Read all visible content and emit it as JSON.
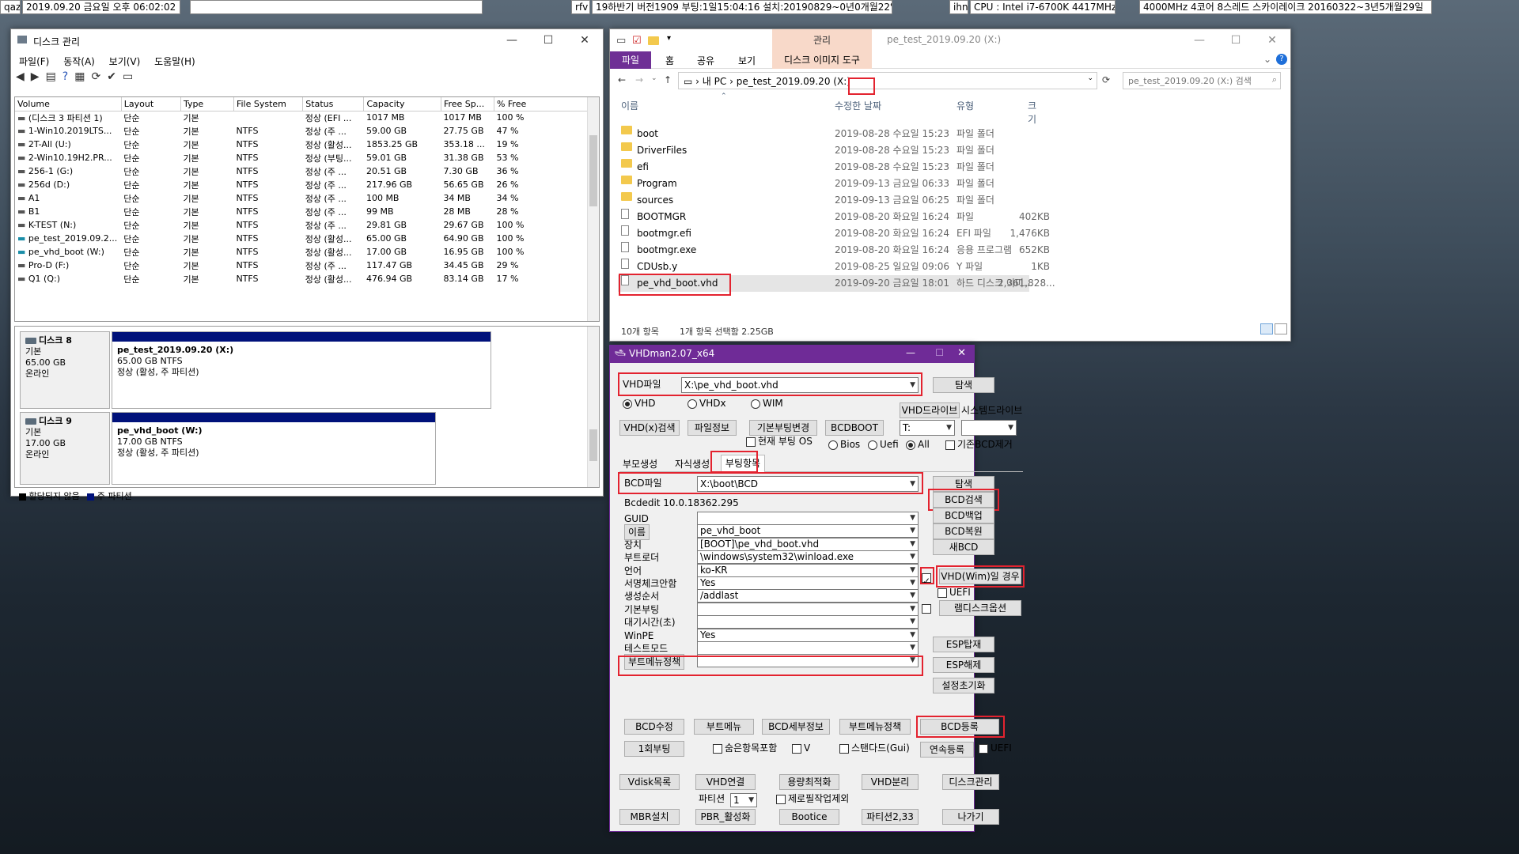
{
  "taskbar": {
    "left_tag": "qaz",
    "datetime": "2019.09.20 금요일 오후 06:02:02",
    "mid_tag": "rfv",
    "build": "19하반기 버전1909 부팅:1일15:04:16 설치:20190829~0년0개월22일",
    "cpu_tag": "ihn",
    "cpu": "CPU : Intel i7-6700K 4417MHz",
    "cpu2": "4000MHz 4코어 8스레드 스카이레이크 20160322~3년5개월29일"
  },
  "disk_mgmt": {
    "title": "디스크 관리",
    "menu": [
      "파일(F)",
      "동작(A)",
      "보기(V)",
      "도움말(H)"
    ],
    "columns": [
      "Volume",
      "Layout",
      "Type",
      "File System",
      "Status",
      "Capacity",
      "Free Sp...",
      "% Free"
    ],
    "rows": [
      [
        "(디스크 3 파티션 1)",
        "단순",
        "기본",
        "",
        "정상 (EFI ...",
        "1017 MB",
        "1017 MB",
        "100 %"
      ],
      [
        "1-Win10.2019LTS...",
        "단순",
        "기본",
        "NTFS",
        "정상 (주 ...",
        "59.00 GB",
        "27.75 GB",
        "47 %"
      ],
      [
        "2T-All (U:)",
        "단순",
        "기본",
        "NTFS",
        "정상 (활성...",
        "1853.25 GB",
        "353.18 ...",
        "19 %"
      ],
      [
        "2-Win10.19H2.PR...",
        "단순",
        "기본",
        "NTFS",
        "정상 (부팅...",
        "59.01 GB",
        "31.38 GB",
        "53 %"
      ],
      [
        "256-1 (G:)",
        "단순",
        "기본",
        "NTFS",
        "정상 (주 ...",
        "20.51 GB",
        "7.30 GB",
        "36 %"
      ],
      [
        "256d (D:)",
        "단순",
        "기본",
        "NTFS",
        "정상 (주 ...",
        "217.96 GB",
        "56.65 GB",
        "26 %"
      ],
      [
        "A1",
        "단순",
        "기본",
        "NTFS",
        "정상 (주 ...",
        "100 MB",
        "34 MB",
        "34 %"
      ],
      [
        "B1",
        "단순",
        "기본",
        "NTFS",
        "정상 (주 ...",
        "99 MB",
        "28 MB",
        "28 %"
      ],
      [
        "K-TEST (N:)",
        "단순",
        "기본",
        "NTFS",
        "정상 (주 ...",
        "29.81 GB",
        "29.67 GB",
        "100 %"
      ],
      [
        "pe_test_2019.09.2...",
        "단순",
        "기본",
        "NTFS",
        "정상 (활성...",
        "65.00 GB",
        "64.90 GB",
        "100 %"
      ],
      [
        "pe_vhd_boot (W:)",
        "단순",
        "기본",
        "NTFS",
        "정상 (활성...",
        "17.00 GB",
        "16.95 GB",
        "100 %"
      ],
      [
        "Pro-D (F:)",
        "단순",
        "기본",
        "NTFS",
        "정상 (주 ...",
        "117.47 GB",
        "34.45 GB",
        "29 %"
      ],
      [
        "Q1 (Q:)",
        "단순",
        "기본",
        "NTFS",
        "정상 (활성...",
        "476.94 GB",
        "83.14 GB",
        "17 %"
      ]
    ],
    "disk8": {
      "name": "디스크 8",
      "type": "기본",
      "size": "65.00 GB",
      "state": "온라인",
      "vol": "pe_test_2019.09.20  (X:)",
      "vol_size": "65.00 GB NTFS",
      "vol_state": "정상 (활성, 주 파티션)"
    },
    "disk9": {
      "name": "디스크 9",
      "type": "기본",
      "size": "17.00 GB",
      "state": "온라인",
      "vol": "pe_vhd_boot  (W:)",
      "vol_size": "17.00 GB NTFS",
      "vol_state": "정상 (활성, 주 파티션)"
    },
    "legend": [
      "할당되지 않음",
      "주 파티션"
    ]
  },
  "explorer": {
    "context_tab": "관리",
    "title": "pe_test_2019.09.20 (X:)",
    "ribbon": [
      "파일",
      "홈",
      "공유",
      "보기",
      "디스크 이미지 도구"
    ],
    "address": [
      "내 PC",
      "pe_test_2019.09.20",
      "(X:)"
    ],
    "search": "pe_test_2019.09.20 (X:) 검색",
    "columns": [
      "이름",
      "수정한 날짜",
      "유형",
      "크기"
    ],
    "rows": [
      {
        "name": "boot",
        "date": "2019-08-28 수요일 15:23",
        "type": "파일 폴더",
        "size": "",
        "folder": true
      },
      {
        "name": "DriverFiles",
        "date": "2019-08-28 수요일 15:23",
        "type": "파일 폴더",
        "size": "",
        "folder": true
      },
      {
        "name": "efi",
        "date": "2019-08-28 수요일 15:23",
        "type": "파일 폴더",
        "size": "",
        "folder": true
      },
      {
        "name": "Program",
        "date": "2019-09-13 금요일 06:33",
        "type": "파일 폴더",
        "size": "",
        "folder": true
      },
      {
        "name": "sources",
        "date": "2019-09-13 금요일 06:25",
        "type": "파일 폴더",
        "size": "",
        "folder": true
      },
      {
        "name": "BOOTMGR",
        "date": "2019-08-20 화요일 16:24",
        "type": "파일",
        "size": "402KB",
        "folder": false
      },
      {
        "name": "bootmgr.efi",
        "date": "2019-08-20 화요일 16:24",
        "type": "EFI 파일",
        "size": "1,476KB",
        "folder": false
      },
      {
        "name": "bootmgr.exe",
        "date": "2019-08-20 화요일 16:24",
        "type": "응용 프로그램",
        "size": "652KB",
        "folder": false
      },
      {
        "name": "CDUsb.y",
        "date": "2019-08-25 일요일 09:06",
        "type": "Y 파일",
        "size": "1KB",
        "folder": false
      },
      {
        "name": "pe_vhd_boot.vhd",
        "date": "2019-09-20 금요일 18:01",
        "type": "하드 디스크 이미...",
        "size": "2,361,828...",
        "folder": false
      }
    ],
    "status_count": "10개 항목",
    "status_sel": "1개 항목 선택함 2.25GB"
  },
  "vhdman": {
    "title": "VHDman2.07_x64",
    "vhd_label": "VHD파일",
    "vhd_value": "X:\\pe_vhd_boot.vhd",
    "browse": "탐색",
    "radios": [
      "VHD",
      "VHDx",
      "WIM"
    ],
    "vhd_drive_label": "VHD드라이브",
    "sys_drive_label": "시스템드라이브",
    "vhd_drive_val": "T:",
    "btn_vhdsearch": "VHD(x)검색",
    "btn_fileinfo": "파일정보",
    "btn_defaultboot": "기본부팅변경",
    "btn_bcdboot": "BCDBOOT",
    "chk_current": "현재 부팅 OS",
    "radio_bios": "Bios",
    "radio_uefi": "Uefi",
    "radio_all": "All",
    "chk_removebcd": "기존BCD제거",
    "tabs": [
      "부모생성",
      "자식생성",
      "부팅항목"
    ],
    "bcd_label": "BCD파일",
    "bcd_value": "X:\\boot\\BCD",
    "bcdedit": "Bcdedit 10.0.18362.295",
    "fields": [
      {
        "label": "GUID",
        "value": ""
      },
      {
        "label": "이름",
        "value": "pe_vhd_boot"
      },
      {
        "label": "장치",
        "value": "[BOOT]\\pe_vhd_boot.vhd"
      },
      {
        "label": "부트로더",
        "value": "\\windows\\system32\\winload.exe"
      },
      {
        "label": "언어",
        "value": "ko-KR"
      },
      {
        "label": "서명체크안함",
        "value": "Yes"
      },
      {
        "label": "생성순서",
        "value": "/addlast"
      },
      {
        "label": "기본부팅",
        "value": ""
      },
      {
        "label": "대기시간(초)",
        "value": ""
      },
      {
        "label": "WinPE",
        "value": "Yes"
      },
      {
        "label": "테스트모드",
        "value": ""
      },
      {
        "label": "부트메뉴정책",
        "value": ""
      }
    ],
    "right_btns": [
      "BCD검색",
      "BCD백업",
      "BCD복원",
      "새BCD"
    ],
    "vhd_wim_case": "VHD(Wim)일 경우",
    "uefi": "UEFI",
    "ramdisk": "램디스크옵션",
    "esp_mount": "ESP탑재",
    "esp_unmount": "ESP해제",
    "reset": "설정초기화",
    "row1": [
      "BCD수정",
      "부트메뉴",
      "BCD세부정보",
      "부트메뉴정책",
      "BCD등록"
    ],
    "row2_btn": "1회부팅",
    "chk_hidden": "숨은항목포함",
    "chk_v": "V",
    "chk_standard": "스탠다드(Gui)",
    "btn_contreg": "연속등록",
    "chk_uefi2": "UEFI",
    "bottom1": [
      "Vdisk목록",
      "VHD연결",
      "용량최적화",
      "VHD분리",
      "디스크관리"
    ],
    "partition_label": "파티션",
    "partition_val": "1",
    "chk_zero": "제로필작업제외",
    "bottom2": [
      "MBR설치",
      "PBR_활성화",
      "Bootice",
      "파티션2,33",
      "나가기"
    ]
  }
}
